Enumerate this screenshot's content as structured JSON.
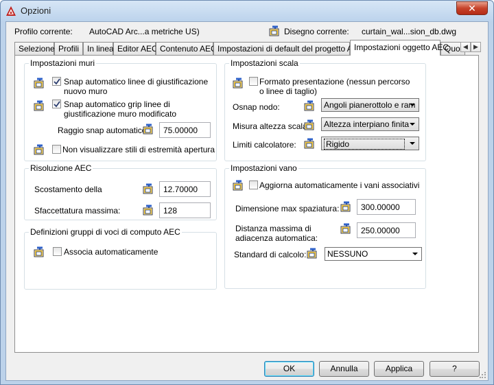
{
  "window": {
    "title": "Opzioni",
    "close_label": "✕"
  },
  "header": {
    "profile_label": "Profilo corrente:",
    "profile_value": "AutoCAD Arc...a metriche US)",
    "drawing_label": "Disegno corrente:",
    "drawing_value": "curtain_wal...sion_db.dwg"
  },
  "tabs": [
    {
      "label": "Selezione"
    },
    {
      "label": "Profili"
    },
    {
      "label": "In linea"
    },
    {
      "label": "Editor AEC"
    },
    {
      "label": "Contenuto AEC"
    },
    {
      "label": "Impostazioni di default del progetto AEC"
    },
    {
      "label": "Impostazioni oggetto AEC"
    },
    {
      "label": "Quota"
    }
  ],
  "walls": {
    "title": "Impostazioni muri",
    "snap_justification": {
      "label": "Snap automatico linee di giustificazione nuovo muro",
      "checked": true
    },
    "snap_grip": {
      "label": "Snap automatico grip linee di giustificazione muro modificato",
      "checked": true
    },
    "radius_label": "Raggio snap automatico:",
    "radius_value": "75.00000",
    "hide_endcap": {
      "label": "Non visualizzare stili di estremità apertura",
      "checked": false
    }
  },
  "aec_resolution": {
    "title": "Risoluzione AEC",
    "offset_label": "Scostamento della",
    "offset_value": "12.70000",
    "facet_label": "Sfaccettatura massima:",
    "facet_value": "128"
  },
  "quantity_groups": {
    "title": "Definizioni gruppi di voci di computo AEC",
    "auto_associate": {
      "label": "Associa automaticamente",
      "checked": false
    }
  },
  "stairs": {
    "title": "Impostazioni scala",
    "presentation": {
      "label": "Formato presentazione (nessun percorso o linee di taglio)",
      "checked": false
    },
    "osnap_label": "Osnap nodo:",
    "osnap_value": "Angoli pianerottolo e ram",
    "height_label": "Misura altezza scala:",
    "height_value": "Altezza interpiano finita",
    "limits_label": "Limiti calcolatore:",
    "limits_value": "Rigido"
  },
  "openings": {
    "title": "Impostazioni vano",
    "auto_update": {
      "label": "Aggiorna automaticamente i vani associativi",
      "checked": false
    },
    "max_spacing_label": "Dimensione max spaziatura:",
    "max_spacing_value": "300.00000",
    "max_adjacency_label": "Distanza massima di adiacenza automatica:",
    "max_adjacency_value": "250.00000",
    "standard_label": "Standard di calcolo:",
    "standard_value": "NESSUNO"
  },
  "buttons": {
    "ok": "OK",
    "cancel": "Annulla",
    "apply": "Applica",
    "help": "?"
  },
  "colors": {
    "title_bar": "#bcd3ec",
    "close_red": "#c7432b",
    "accent_border": "#3c7fb1"
  },
  "icons": {
    "drawing": "drawing-settings-icon",
    "app": "autocad-logo-icon"
  }
}
